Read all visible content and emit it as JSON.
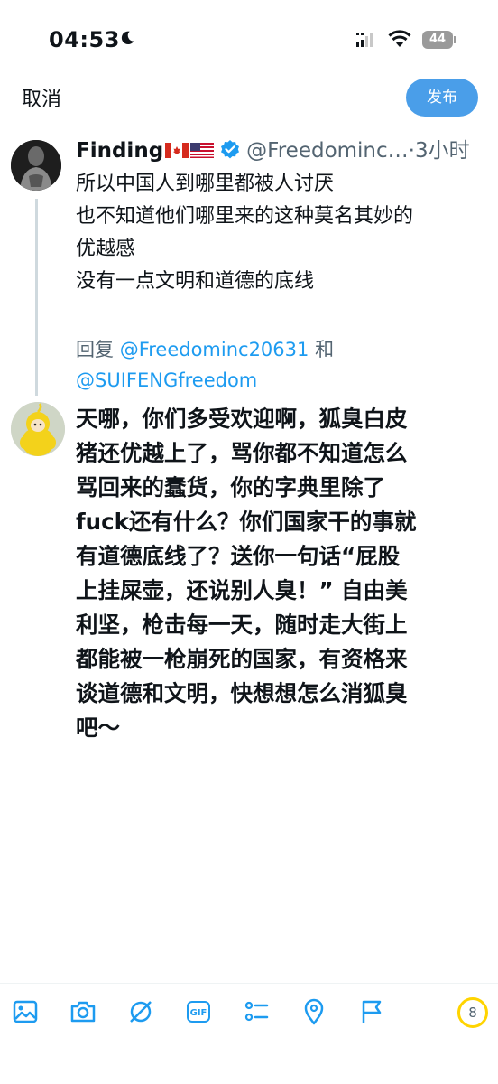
{
  "status_bar": {
    "time": "04:53",
    "battery": "44"
  },
  "compose": {
    "cancel_label": "取消",
    "post_label": "发布"
  },
  "original_tweet": {
    "author_name": "Finding",
    "handle": "@Freedominc…",
    "separator": "·",
    "time_ago": "3小时",
    "lines": [
      "所以中国人到哪里都被人讨厌",
      "也不知道他们哪里来的这种莫名其妙的",
      "优越感",
      "没有一点文明和道德的底线"
    ]
  },
  "replying_to": {
    "prefix": "回复 ",
    "mention1": "@Freedominc20631",
    "conjunction": " 和",
    "mention2": "@SUIFENGfreedom"
  },
  "reply": {
    "lines": [
      "天哪，你们多受欢迎啊，狐臭白皮",
      "猪还优越上了，骂你都不知道怎么",
      "骂回来的蠢货，你的字典里除了",
      "fuck还有什么？你们国家干的事就",
      "有道德底线了？送你一句话“屁股",
      "上挂屎壶，还说别人臭！” 自由美",
      "利坚，枪击每一天，随时走大街上",
      "都能被一枪崩死的国家，有资格来",
      "谈道德和文明，快想想怎么消狐臭",
      "吧～"
    ]
  },
  "toolbar": {
    "icons": [
      "image-icon",
      "camera-icon",
      "grok-icon",
      "gif-icon",
      "poll-icon",
      "location-icon",
      "flag-icon"
    ],
    "gif_label": "GIF",
    "char_remaining": "8"
  },
  "colors": {
    "accent": "#1d9bf0",
    "post_button": "#4a9ee9",
    "counter_ring": "#ffd400",
    "muted": "#536471"
  }
}
